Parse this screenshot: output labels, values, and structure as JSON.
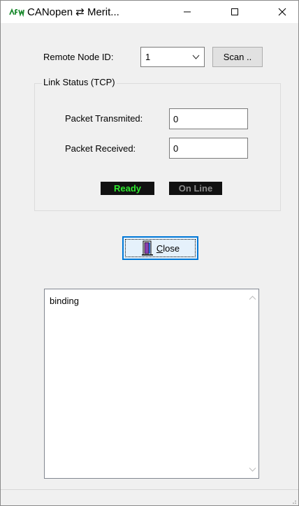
{
  "window": {
    "title": "CANopen ⇄ Merit...",
    "minimize_glyph": "—",
    "maximize_glyph": "☐",
    "close_glyph": "✕"
  },
  "remote": {
    "label": "Remote Node ID:",
    "selected": "1",
    "scan_label": "Scan .."
  },
  "link_status": {
    "title": "Link Status (TCP)",
    "tx_label": "Packet Transmited:",
    "tx_value": "0",
    "rx_label": "Packet Received:",
    "rx_value": "0",
    "ready_label": "Ready",
    "online_label": "On Line"
  },
  "close_button": {
    "label_accel": "C",
    "label_rest": "lose"
  },
  "log": {
    "items": [
      "binding"
    ]
  },
  "colors": {
    "ready_text": "#2ee82e",
    "online_text": "#8e8e8e",
    "focus_border": "#0078d7"
  }
}
